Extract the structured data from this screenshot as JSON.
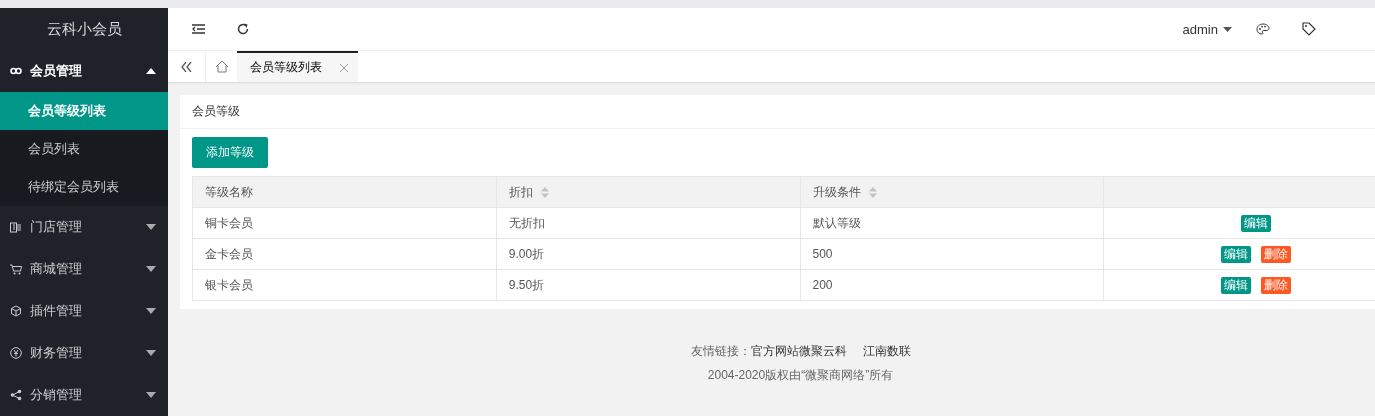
{
  "sidebar": {
    "title": "云科小会员",
    "menus": [
      {
        "label": "会员管理",
        "expanded": true,
        "children": [
          {
            "label": "会员等级列表",
            "selected": true
          },
          {
            "label": "会员列表",
            "selected": false
          },
          {
            "label": "待绑定会员列表",
            "selected": false
          }
        ]
      },
      {
        "label": "门店管理",
        "expanded": false
      },
      {
        "label": "商城管理",
        "expanded": false
      },
      {
        "label": "插件管理",
        "expanded": false
      },
      {
        "label": "财务管理",
        "expanded": false
      },
      {
        "label": "分销管理",
        "expanded": false
      }
    ]
  },
  "header": {
    "user": "admin"
  },
  "tabs": [
    {
      "label": "会员等级列表",
      "selected": true
    }
  ],
  "card": {
    "title": "会员等级",
    "add_button": "添加等级",
    "table": {
      "columns": [
        {
          "label": "等级名称",
          "sortable": false
        },
        {
          "label": "折扣",
          "sortable": true
        },
        {
          "label": "升级条件",
          "sortable": true
        }
      ],
      "rows": [
        {
          "cells": [
            "铜卡会员",
            "无折扣",
            "默认等级"
          ],
          "actions": [
            {
              "label": "编辑",
              "kind": "edit"
            }
          ]
        },
        {
          "cells": [
            "金卡会员",
            "9.00折",
            "500"
          ],
          "actions": [
            {
              "label": "编辑",
              "kind": "edit"
            },
            {
              "label": "删除",
              "kind": "delete"
            }
          ]
        },
        {
          "cells": [
            "银卡会员",
            "9.50折",
            "200"
          ],
          "actions": [
            {
              "label": "编辑",
              "kind": "edit"
            },
            {
              "label": "删除",
              "kind": "delete"
            }
          ]
        }
      ]
    }
  },
  "footer": {
    "links_label": "友情链接：",
    "links": [
      "官方网站微聚云科",
      "江南数联"
    ],
    "copyright": "2004-2020版权由“微聚商网络”所有"
  }
}
